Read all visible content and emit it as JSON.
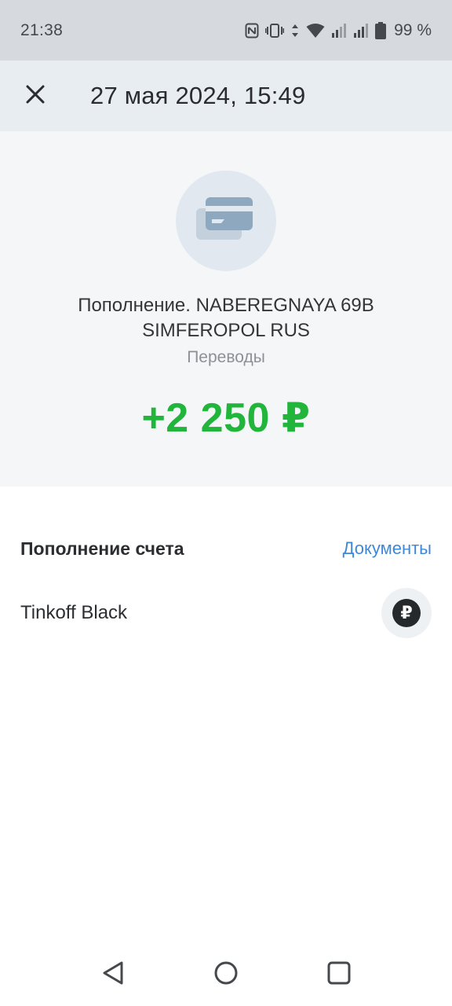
{
  "status_bar": {
    "time": "21:38",
    "battery": "99 %",
    "icons": [
      "nfc-icon",
      "vibrate-icon",
      "data-arrows-icon",
      "wifi-icon",
      "signal-icon",
      "signal-icon",
      "battery-icon"
    ]
  },
  "header": {
    "title": "27 мая 2024, 15:49",
    "close_icon": "close-icon"
  },
  "hero": {
    "icon": "card-icon",
    "merchant": "Пополнение. NABEREGNAYA 69B SIMFEROPOL RUS",
    "category": "Переводы",
    "amount": "+2 250 ₽",
    "amount_color": "#21b53b"
  },
  "section": {
    "title": "Пополнение счета",
    "documents_link": "Документы",
    "link_color": "#3f88d9"
  },
  "account": {
    "name": "Tinkoff Black",
    "currency_symbol": "₽"
  },
  "nav_bar": {
    "buttons": [
      "back-icon",
      "home-icon",
      "recents-icon"
    ]
  }
}
